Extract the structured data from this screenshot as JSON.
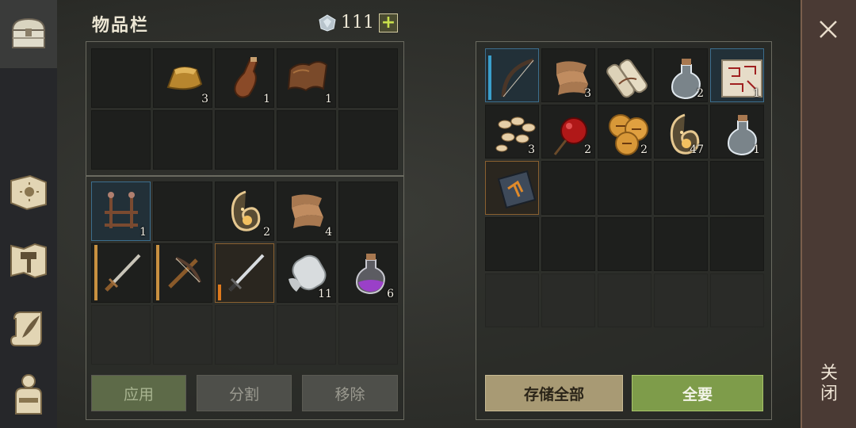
{
  "header": {
    "title": "物品栏",
    "currency_value": "111",
    "currency_icon": "gem-icon",
    "add_label": "+"
  },
  "sidebar": {
    "items": [
      {
        "name": "chest-icon",
        "active": true
      },
      {
        "name": "sun-book-icon",
        "active": false
      },
      {
        "name": "hammer-map-icon",
        "active": false
      },
      {
        "name": "quill-scroll-icon",
        "active": false
      },
      {
        "name": "character-icon",
        "active": false
      }
    ]
  },
  "inventory": {
    "top": [
      {
        "item": "",
        "qty": ""
      },
      {
        "item": "gold-ingot-icon",
        "qty": "3"
      },
      {
        "item": "bottle-icon",
        "qty": "1"
      },
      {
        "item": "leather-icon",
        "qty": "1"
      },
      {
        "item": "",
        "qty": ""
      },
      {
        "item": "",
        "qty": ""
      },
      {
        "item": "",
        "qty": ""
      },
      {
        "item": "",
        "qty": ""
      },
      {
        "item": "",
        "qty": ""
      },
      {
        "item": "",
        "qty": ""
      }
    ],
    "bottom": [
      {
        "item": "rack-icon",
        "qty": "1"
      },
      {
        "item": "",
        "qty": ""
      },
      {
        "item": "essence-icon",
        "qty": "2"
      },
      {
        "item": "cloth-icon",
        "qty": "4"
      },
      {
        "item": "",
        "qty": ""
      },
      {
        "item": "sword-icon",
        "qty": ""
      },
      {
        "item": "crossbow-icon",
        "qty": ""
      },
      {
        "item": "steel-sword-icon",
        "qty": ""
      },
      {
        "item": "bandage-icon",
        "qty": "11"
      },
      {
        "item": "purple-potion-icon",
        "qty": "6"
      }
    ],
    "buttons": {
      "apply": "应用",
      "split": "分割",
      "remove": "移除"
    }
  },
  "storage": {
    "slots": [
      {
        "item": "bow-icon",
        "qty": ""
      },
      {
        "item": "cloth-icon",
        "qty": "3"
      },
      {
        "item": "paper-roll-icon",
        "qty": ""
      },
      {
        "item": "potion-icon",
        "qty": "2"
      },
      {
        "item": "map-scroll-icon",
        "qty": "1"
      },
      {
        "item": "seeds-icon",
        "qty": "3"
      },
      {
        "item": "candy-apple-icon",
        "qty": "2"
      },
      {
        "item": "cookies-icon",
        "qty": "2"
      },
      {
        "item": "essence-icon",
        "qty": "47"
      },
      {
        "item": "potion-icon",
        "qty": "1"
      },
      {
        "item": "book-icon",
        "qty": ""
      }
    ],
    "buttons": {
      "store_all": "存储全部",
      "take_all": "全要"
    }
  },
  "close": {
    "label": "关闭"
  },
  "colors": {
    "take_button": "#7e9c4a",
    "store_button": "#a89a74",
    "apply_button": "#5d6a48",
    "durability": "#c89040",
    "accent_blue": "#3aa0cc"
  }
}
